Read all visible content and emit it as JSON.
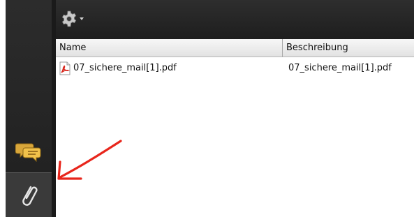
{
  "sidebar": {
    "buttons": [
      {
        "icon": "comments-icon"
      },
      {
        "icon": "paperclip-icon",
        "selected": true
      }
    ]
  },
  "toolbar": {
    "options_icon": "gear-icon"
  },
  "table": {
    "columns": [
      "Name",
      "Beschreibung"
    ],
    "rows": [
      {
        "icon": "pdf-file-icon",
        "name": "07_sichere_mail[1].pdf",
        "description": "07_sichere_mail[1].pdf"
      }
    ]
  },
  "annotation": {
    "type": "arrow",
    "color": "#e8261c"
  },
  "colors": {
    "sidebar_bg": "#262626",
    "toolbar_bg": "#262626",
    "header_bg": "#ebebeb",
    "annotation": "#e8261c"
  }
}
